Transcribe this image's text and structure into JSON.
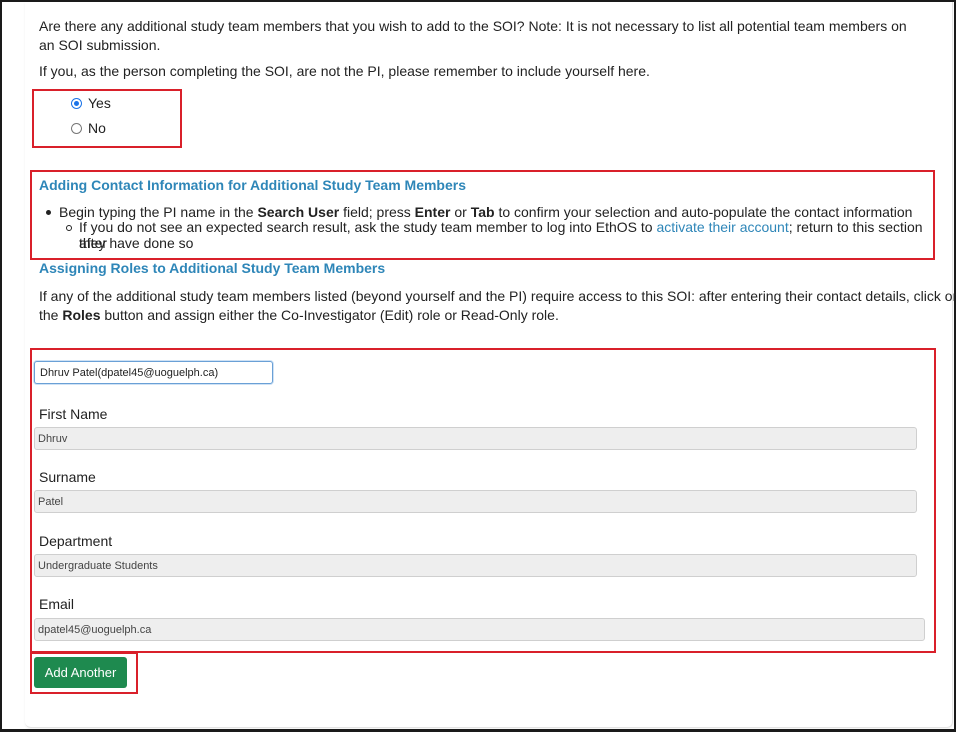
{
  "question": {
    "text": "Are there any additional study team members that you wish to add to the SOI? Note: It is not necessary to list all potential team members on an SOI submission.",
    "note": "If you, as the person completing the SOI, are not the PI, please remember to include yourself here."
  },
  "radio": {
    "options": [
      {
        "label": "Yes",
        "selected": true
      },
      {
        "label": "No",
        "selected": false
      }
    ]
  },
  "contact_info": {
    "heading": "Adding Contact Information for Additional Study Team Members",
    "bullet": {
      "part1": "Begin typing the PI name in the ",
      "bold1": "Search User",
      "part2": " field; press ",
      "bold2": "Enter",
      "part3": " or ",
      "bold3": "Tab",
      "part4": " to confirm your selection and auto-populate the contact information"
    },
    "subbullet": {
      "part1": "If you do not see an expected search result, ask the study team member to log into EthOS to ",
      "link": "activate their account",
      "part2": "; return to this section after",
      "line2": "they have done so"
    }
  },
  "roles": {
    "heading": "Assigning Roles to Additional Study Team Members",
    "line1": "If any of the additional study team members listed (beyond yourself and the PI) require access to this SOI: after entering their contact details, click on",
    "the": "the ",
    "roles_bold": "Roles",
    "line2_rest": " button and assign either the Co-Investigator (Edit) role or Read-Only role."
  },
  "form": {
    "search_value": "Dhruv Patel(dpatel45@uoguelph.ca)",
    "first_name_label": "First Name",
    "first_name_value": "Dhruv",
    "surname_label": "Surname",
    "surname_value": "Patel",
    "department_label": "Department",
    "department_value": "Undergraduate Students",
    "email_label": "Email",
    "email_value": "dpatel45@uoguelph.ca"
  },
  "add_another_label": "Add Another",
  "colors": {
    "highlight": "#d9202a",
    "heading": "#2e86b8",
    "button": "#1e8a4f"
  }
}
